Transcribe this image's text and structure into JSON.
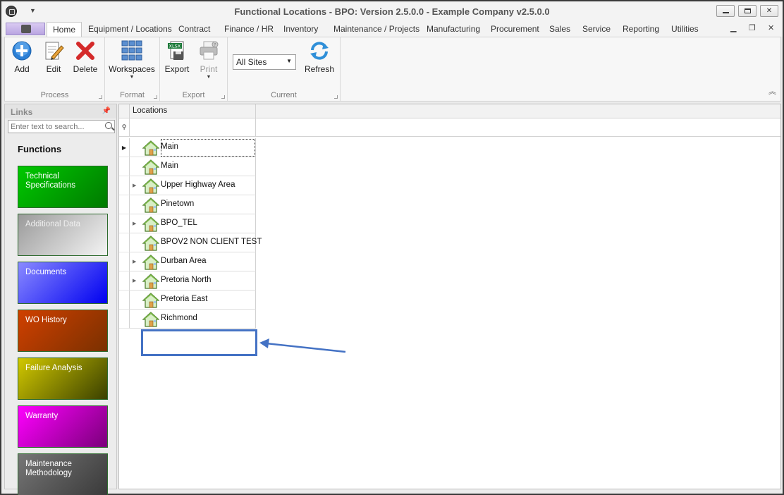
{
  "window": {
    "title": "Functional Locations - BPO: Version 2.5.0.0 - Example Company v2.5.0.0"
  },
  "menu": {
    "tabs": [
      "Home",
      "Equipment / Locations",
      "Contract",
      "Finance / HR",
      "Inventory",
      "Maintenance / Projects",
      "Manufacturing",
      "Procurement",
      "Sales",
      "Service",
      "Reporting",
      "Utilities"
    ],
    "active_tab": "Home"
  },
  "ribbon": {
    "process": {
      "label": "Process",
      "add": "Add",
      "edit": "Edit",
      "delete": "Delete"
    },
    "format": {
      "label": "Format",
      "workspaces": "Workspaces"
    },
    "export": {
      "label": "Export",
      "export": "Export",
      "print": "Print"
    },
    "current": {
      "label": "Current",
      "site_select": "All Sites",
      "refresh": "Refresh"
    }
  },
  "links": {
    "title": "Links",
    "search_placeholder": "Enter text to search...",
    "functions_heading": "Functions",
    "tiles": [
      {
        "label": "Technical Specifications",
        "color_from": "#00c000",
        "color_to": "#008000"
      },
      {
        "label": "Additional Data",
        "color_from": "#9a9a9a",
        "color_to": "#f4f4f4"
      },
      {
        "label": "Documents",
        "color_from": "#8080ff",
        "color_to": "#0000ff"
      },
      {
        "label": "WO History",
        "color_from": "#d04000",
        "color_to": "#7a3000"
      },
      {
        "label": "Failure Analysis",
        "color_from": "#c8c000",
        "color_to": "#3a4000"
      },
      {
        "label": "Warranty",
        "color_from": "#ff00ff",
        "color_to": "#800080"
      },
      {
        "label": "Maintenance Methodology",
        "color_from": "#707070",
        "color_to": "#404040"
      }
    ]
  },
  "grid": {
    "column_header": "Locations",
    "rows": [
      {
        "label": "Main",
        "expandable": false,
        "selected": true
      },
      {
        "label": "Main",
        "expandable": false,
        "selected": false
      },
      {
        "label": "Upper Highway Area",
        "expandable": true,
        "selected": false
      },
      {
        "label": "Pinetown",
        "expandable": false,
        "selected": false
      },
      {
        "label": "BPO_TEL",
        "expandable": true,
        "selected": false
      },
      {
        "label": "BPOV2 NON CLIENT TEST",
        "expandable": false,
        "selected": false
      },
      {
        "label": "Durban Area",
        "expandable": true,
        "selected": false
      },
      {
        "label": "Pretoria North",
        "expandable": true,
        "selected": false
      },
      {
        "label": "Pretoria East",
        "expandable": false,
        "selected": false
      },
      {
        "label": "Richmond",
        "expandable": false,
        "selected": false
      }
    ]
  },
  "annotation": {
    "color": "#4472c4"
  }
}
